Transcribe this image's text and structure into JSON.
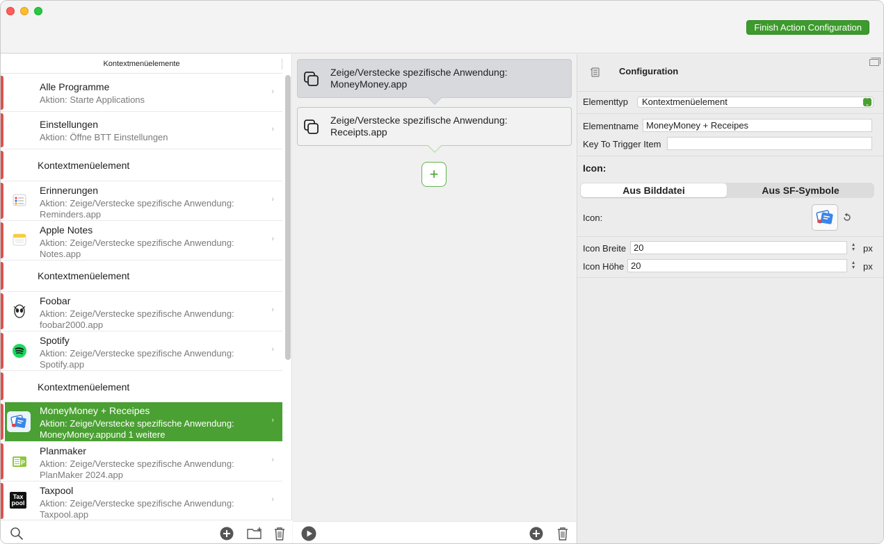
{
  "titlebar": {
    "finish_label": "Finish Action Configuration"
  },
  "left": {
    "header": "Kontextmenüelemente",
    "rows": [
      {
        "title": "Alle Programme",
        "sub1": "Aktion: Starte Applications",
        "sub2": ""
      },
      {
        "title": "Einstellungen",
        "sub1": "Aktion: Öffne BTT Einstellungen",
        "sub2": ""
      },
      {
        "title": "Kontextmenüelement"
      },
      {
        "title": "Erinnerungen",
        "sub1": "Aktion: Zeige/Verstecke spezifische Anwendung:",
        "sub2": "Reminders.app"
      },
      {
        "title": "Apple Notes",
        "sub1": "Aktion: Zeige/Verstecke spezifische Anwendung:",
        "sub2": "Notes.app"
      },
      {
        "title": "Kontextmenüelement"
      },
      {
        "title": "Foobar",
        "sub1": "Aktion: Zeige/Verstecke spezifische Anwendung:",
        "sub2": "foobar2000.app"
      },
      {
        "title": "Spotify",
        "sub1": "Aktion: Zeige/Verstecke spezifische Anwendung:",
        "sub2": "Spotify.app"
      },
      {
        "title": "Kontextmenüelement"
      },
      {
        "title": "MoneyMoney + Receipes",
        "sub1": "Aktion: Zeige/Verstecke spezifische Anwendung:",
        "sub2": "MoneyMoney.appund 1 weitere"
      },
      {
        "title": "Planmaker",
        "sub1": "Aktion: Zeige/Verstecke spezifische Anwendung:",
        "sub2": "PlanMaker 2024.app"
      },
      {
        "title": "Taxpool",
        "sub1": "Aktion: Zeige/Verstecke spezifische Anwendung:",
        "sub2": "Taxpool.app",
        "icon_text_1": "Tax",
        "icon_text_2": "pool"
      }
    ],
    "chevron": "›"
  },
  "middle": {
    "actions": [
      {
        "line1": "Zeige/Verstecke spezifische Anwendung:",
        "line2": "MoneyMoney.app"
      },
      {
        "line1": "Zeige/Verstecke spezifische Anwendung:",
        "line2": "Receipts.app"
      }
    ],
    "add_symbol": "+"
  },
  "config": {
    "title": "Configuration",
    "elementtyp_label": "Elementtyp",
    "elementtyp_value": "Kontextmenüelement",
    "elementname_label": "Elementname",
    "elementname_value": "MoneyMoney + Receipes",
    "key_label": "Key To Trigger Item",
    "key_value": "",
    "icon_section": "Icon:",
    "seg_left": "Aus Bilddatei",
    "seg_right": "Aus SF-Symbole",
    "icon_label": "Icon:",
    "icon_breite_label": "Icon Breite",
    "icon_breite_value": "20",
    "icon_hoehe_label": "Icon Höhe",
    "icon_hoehe_value": "20",
    "unit": "px"
  },
  "colors": {
    "accent": "#4aa032",
    "finish_button": "#3d9a2c",
    "row_marker": "#d9534f"
  }
}
